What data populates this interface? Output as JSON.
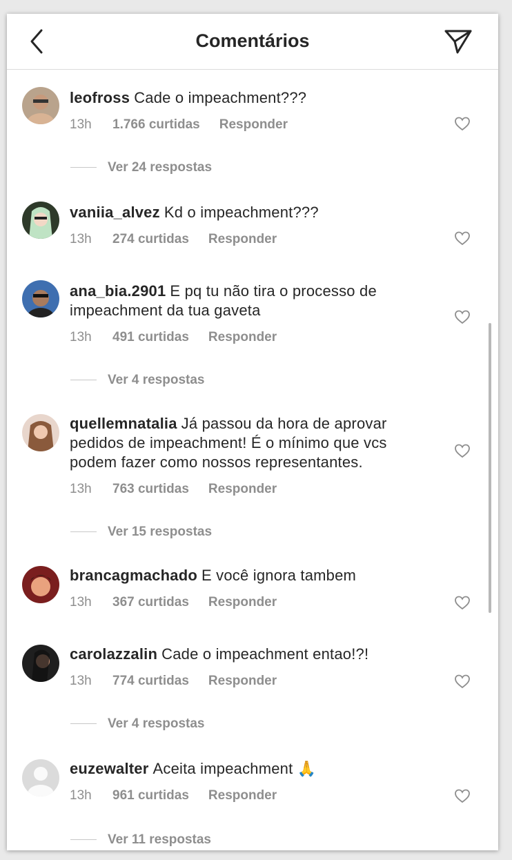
{
  "header": {
    "title": "Comentários",
    "back_icon": "chevron-left-icon",
    "send_icon": "paper-plane-icon"
  },
  "comments": [
    {
      "username": "leofross",
      "text": "Cade o impeachment???",
      "time": "13h",
      "likes": "1.766 curtidas",
      "reply": "Responder",
      "replies": "Ver 24 respostas"
    },
    {
      "username": "vaniia_alvez",
      "text": "Kd o impeachment???",
      "time": "13h",
      "likes": "274 curtidas",
      "reply": "Responder",
      "replies": ""
    },
    {
      "username": "ana_bia.2901",
      "text": "E pq tu não tira o processo de impeachment da tua gaveta",
      "time": "13h",
      "likes": "491 curtidas",
      "reply": "Responder",
      "replies": "Ver 4 respostas"
    },
    {
      "username": "quellemnatalia",
      "text": "Já passou da hora de aprovar pedidos de impeachment! É o mínimo que vcs podem fazer como nossos representantes.",
      "time": "13h",
      "likes": "763 curtidas",
      "reply": "Responder",
      "replies": "Ver 15 respostas"
    },
    {
      "username": "brancagmachado",
      "text": "E você ignora tambem",
      "time": "13h",
      "likes": "367 curtidas",
      "reply": "Responder",
      "replies": ""
    },
    {
      "username": "carolazzalin",
      "text": "Cade o impeachment entao!?!",
      "time": "13h",
      "likes": "774 curtidas",
      "reply": "Responder",
      "replies": "Ver 4 respostas"
    },
    {
      "username": "euzewalter",
      "text": "Aceita impeachment 🙏",
      "time": "13h",
      "likes": "961 curtidas",
      "reply": "Responder",
      "replies": "Ver 11 respostas"
    }
  ],
  "colors": {
    "text": "#262626",
    "secondary": "#8e8e8e",
    "divider": "#dbdbdb"
  }
}
